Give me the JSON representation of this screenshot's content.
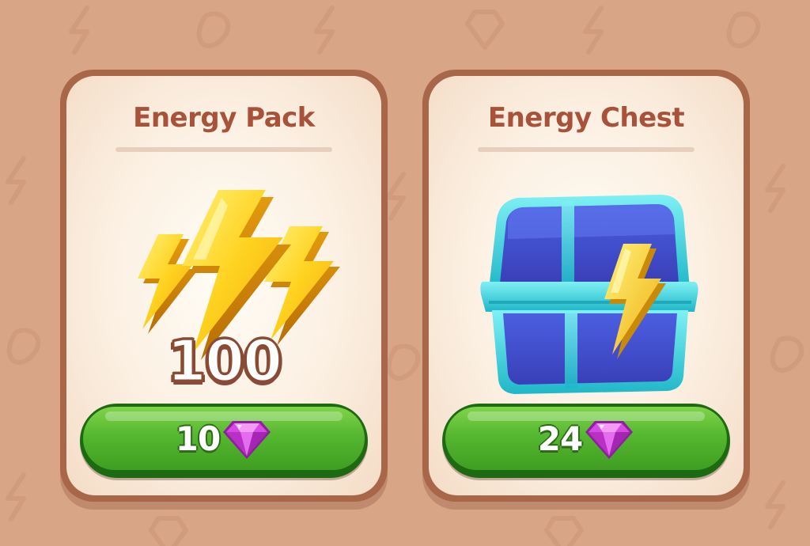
{
  "colors": {
    "background": "#d8a587",
    "card_border": "#a9674a",
    "title": "#a8523a",
    "button_green": "#56b730",
    "gem": "#c23ad0"
  },
  "cards": [
    {
      "title": "Energy Pack",
      "amount": "100",
      "icon": "energy-bolts-icon",
      "price": "10",
      "currency_icon": "gem-icon"
    },
    {
      "title": "Energy Chest",
      "icon": "energy-chest-icon",
      "price": "24",
      "currency_icon": "gem-icon"
    }
  ]
}
